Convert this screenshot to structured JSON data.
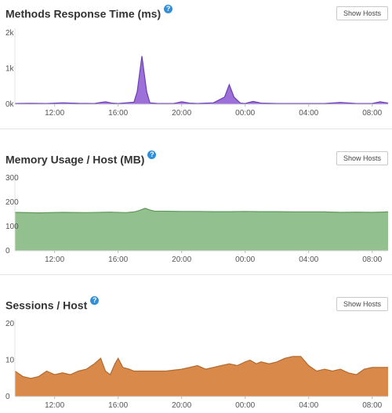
{
  "colors": {
    "response_fill": "#9d6fd8",
    "response_line": "#6b3fb5",
    "memory_fill": "#93c08f",
    "memory_line": "#5f9a5a",
    "sessions_fill": "#d9894a",
    "sessions_line": "#b36a2e",
    "help_icon": "#2f8fd8"
  },
  "panels": [
    {
      "title": "Methods Response Time (ms)",
      "button_label": "Show Hosts",
      "help_icon": "question-circle-icon"
    },
    {
      "title": "Memory Usage / Host (MB)",
      "button_label": "Show Hosts",
      "help_icon": "question-circle-icon"
    },
    {
      "title": "Sessions / Host",
      "button_label": "Show Hosts",
      "help_icon": "question-circle-icon"
    }
  ],
  "chart_data": [
    {
      "type": "area",
      "title": "Methods Response Time (ms)",
      "ylim": [
        0,
        2000
      ],
      "yticks": [
        0,
        1000,
        2000
      ],
      "ytick_labels": [
        "0k",
        "1k",
        "2k"
      ],
      "xlim": [
        9.5,
        33.0
      ],
      "xticks": [
        12,
        16,
        20,
        24,
        28,
        32
      ],
      "xtick_labels": [
        "12:00",
        "16:00",
        "20:00",
        "00:00",
        "04:00",
        "08:00"
      ],
      "grid": false,
      "x": [
        9.5,
        10.5,
        11.5,
        12.5,
        13.5,
        14.5,
        15.2,
        15.6,
        16.0,
        16.5,
        17.0,
        17.2,
        17.5,
        17.8,
        18.0,
        18.5,
        19.5,
        20.0,
        20.5,
        21.0,
        22.0,
        22.7,
        23.0,
        23.3,
        23.7,
        24.0,
        24.5,
        25.0,
        26.0,
        27.0,
        28.0,
        29.0,
        30.0,
        31.0,
        32.0,
        32.5,
        33.0
      ],
      "values": [
        20,
        25,
        20,
        40,
        25,
        20,
        70,
        30,
        20,
        40,
        60,
        350,
        1350,
        350,
        40,
        20,
        20,
        70,
        30,
        20,
        40,
        200,
        550,
        200,
        30,
        20,
        80,
        30,
        20,
        20,
        20,
        20,
        50,
        20,
        20,
        70,
        30
      ]
    },
    {
      "type": "area",
      "title": "Memory Usage / Host (MB)",
      "ylim": [
        0,
        300
      ],
      "yticks": [
        0,
        100,
        200,
        300
      ],
      "ytick_labels": [
        "0",
        "100",
        "200",
        "300"
      ],
      "xlim": [
        9.5,
        33.0
      ],
      "xticks": [
        12,
        16,
        20,
        24,
        28,
        32
      ],
      "xtick_labels": [
        "12:00",
        "16:00",
        "20:00",
        "00:00",
        "04:00",
        "08:00"
      ],
      "grid": false,
      "x": [
        9.5,
        11.0,
        12.5,
        14.0,
        15.5,
        16.5,
        17.0,
        17.3,
        17.7,
        18.0,
        18.3,
        19.0,
        20.0,
        21.0,
        22.0,
        23.0,
        24.0,
        25.0,
        26.0,
        27.0,
        28.0,
        29.0,
        30.0,
        31.0,
        32.0,
        33.0
      ],
      "values": [
        158,
        156,
        158,
        157,
        159,
        157,
        160,
        165,
        175,
        168,
        163,
        163,
        162,
        162,
        161,
        161,
        162,
        161,
        161,
        160,
        160,
        160,
        158,
        159,
        158,
        160
      ]
    },
    {
      "type": "area",
      "title": "Sessions / Host",
      "ylim": [
        0,
        20
      ],
      "yticks": [
        0,
        10,
        20
      ],
      "ytick_labels": [
        "0",
        "10",
        "20"
      ],
      "xlim": [
        9.5,
        33.0
      ],
      "xticks": [
        12,
        16,
        20,
        24,
        28,
        32
      ],
      "xtick_labels": [
        "12:00",
        "16:00",
        "20:00",
        "00:00",
        "04:00",
        "08:00"
      ],
      "grid": false,
      "x": [
        9.5,
        10.0,
        10.5,
        11.0,
        11.5,
        12.0,
        12.5,
        13.0,
        13.5,
        14.0,
        14.5,
        14.9,
        15.2,
        15.5,
        15.8,
        16.0,
        16.3,
        16.7,
        17.0,
        18.0,
        19.0,
        20.0,
        20.5,
        21.0,
        21.5,
        22.0,
        22.5,
        23.0,
        23.5,
        24.0,
        24.3,
        24.7,
        25.0,
        25.5,
        26.0,
        26.5,
        27.0,
        27.5,
        28.0,
        28.5,
        29.0,
        29.5,
        30.0,
        30.5,
        31.0,
        31.5,
        32.0,
        32.5,
        33.0
      ],
      "values": [
        7,
        5.5,
        5,
        5.5,
        7,
        6,
        6.5,
        6,
        7,
        7.5,
        9,
        10.5,
        7,
        6,
        9,
        10.5,
        8,
        7.5,
        7,
        7,
        7,
        7.5,
        8,
        8.5,
        7.5,
        8,
        8.5,
        9,
        8.5,
        9.5,
        10,
        9,
        9.5,
        9,
        9.5,
        10.5,
        11,
        11,
        8.5,
        7,
        7.5,
        7,
        7.5,
        6.5,
        6,
        7.5,
        8,
        8,
        8
      ]
    }
  ]
}
